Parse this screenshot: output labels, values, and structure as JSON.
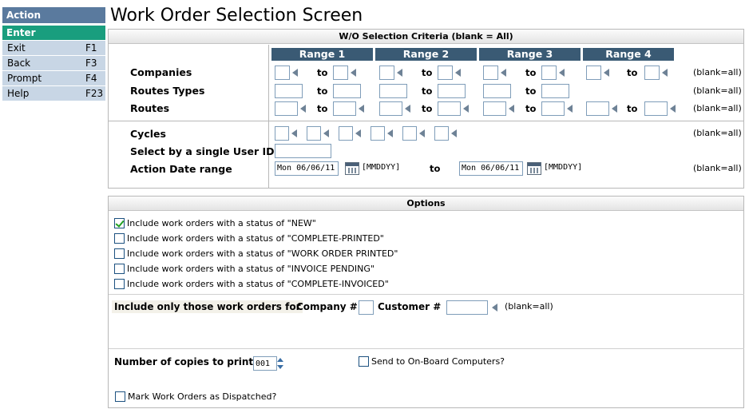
{
  "action_panel": {
    "header": "Action",
    "enter": "Enter",
    "items": [
      {
        "label": "Exit",
        "key": "F1"
      },
      {
        "label": "Back",
        "key": "F3"
      },
      {
        "label": "Prompt",
        "key": "F4"
      },
      {
        "label": "Help",
        "key": "F23"
      }
    ]
  },
  "page_title": "Work Order Selection Screen",
  "criteria": {
    "header": "W/O Selection Criteria (blank = All)",
    "ranges": [
      "Range 1",
      "Range 2",
      "Range 3",
      "Range 4"
    ],
    "to_label": "to",
    "blank_all": "(blank=all)",
    "rows": {
      "companies": "Companies",
      "route_types": "Routes Types",
      "routes": "Routes"
    },
    "cycles_label": "Cycles",
    "user_id_label": "Select by a single User ID",
    "user_id_value": "",
    "date_range_label": "Action Date range",
    "date_from": "Mon 06/06/11",
    "date_to": "Mon 06/06/11",
    "date_format": "[MMDDYY]"
  },
  "options": {
    "header": "Options",
    "statuses": [
      {
        "label": "Include work orders with a status of \"NEW\"",
        "checked": true
      },
      {
        "label": "Include work orders with a status of \"COMPLETE-PRINTED\"",
        "checked": false
      },
      {
        "label": "Include work orders with a status of \"WORK ORDER PRINTED\"",
        "checked": false
      },
      {
        "label": "Include work orders with a status of \"INVOICE PENDING\"",
        "checked": false
      },
      {
        "label": "Include work orders with a status of \"COMPLETE-INVOICED\"",
        "checked": false
      }
    ],
    "include_only_label": "Include only those work orders for",
    "company_label": "Company #",
    "company_value": "",
    "customer_label": "Customer #",
    "customer_value": "",
    "customer_blank": "(blank=all)",
    "copies_label": "Number of copies to print",
    "copies_value": "001",
    "send_onboard_label": "Send to On-Board Computers?",
    "send_onboard_checked": false,
    "mark_dispatched_label": "Mark Work Orders as Dispatched?",
    "mark_dispatched_checked": false
  }
}
